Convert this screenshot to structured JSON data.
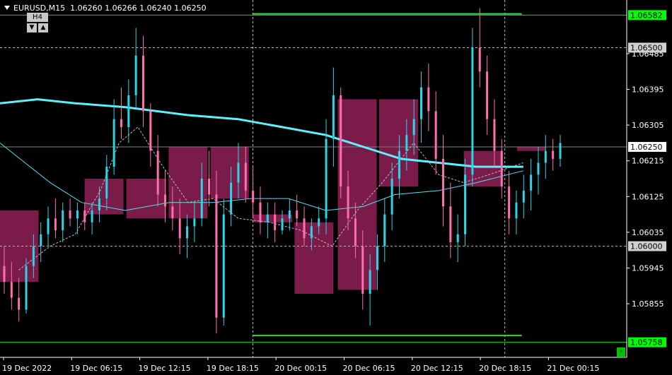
{
  "header": {
    "symbol": "EURUSD,M15",
    "ohlc": "1.06260 1.06266 1.06240 1.06250",
    "timeframe_badge": "H4",
    "btn_down": "▼",
    "btn_up": "▲",
    "corner_btn": "-"
  },
  "chart_data": {
    "type": "candlestick",
    "symbol": "EURUSD",
    "timeframe": "M15",
    "ylim": [
      1.0572,
      1.0662
    ],
    "y_ticks": [
      "1.06485",
      "1.06395",
      "1.06305",
      "1.06215",
      "1.06125",
      "1.06035",
      "1.05945",
      "1.05855"
    ],
    "x_ticks": [
      "19 Dec 2022",
      "19 Dec 06:15",
      "19 Dec 12:15",
      "19 Dec 18:15",
      "20 Dec 00:15",
      "20 Dec 06:15",
      "20 Dec 12:15",
      "20 Dec 18:15",
      "21 Dec 00:15"
    ],
    "price_tags": [
      {
        "value": "1.06582",
        "color": "#00ff00"
      },
      {
        "value": "1.06500",
        "color": "#d0d0d0"
      },
      {
        "value": "1.06250",
        "color": "#ffffff"
      },
      {
        "value": "1.06000",
        "color": "#d0d0d0"
      },
      {
        "value": "1.05758",
        "color": "#00ff00"
      }
    ],
    "horizontal_lines": [
      {
        "value": 1.06582,
        "style": "solid",
        "color": "#00e000"
      },
      {
        "value": 1.065,
        "style": "dotted",
        "color": "#bbbbbb"
      },
      {
        "value": 1.0625,
        "style": "solid-thin",
        "color": "#7f7f7f"
      },
      {
        "value": 1.06,
        "style": "dotted",
        "color": "#bbbbbb"
      },
      {
        "value": 1.05758,
        "style": "solid",
        "color": "#00e000"
      }
    ],
    "segments": [
      {
        "x0": 0.4035,
        "x1": 0.8325,
        "value": 1.06585,
        "color": "#33dd33"
      },
      {
        "x0": 0.4035,
        "x1": 0.8325,
        "value": 1.05775,
        "color": "#33dd33"
      }
    ],
    "v_separators": [
      0.4035,
      0.8055
    ],
    "h4_boxes": [
      {
        "x0": 0.0,
        "x1": 0.0615,
        "o": 1.0609,
        "c": 1.0591
      },
      {
        "x0": 0.135,
        "x1": 0.197,
        "o": 1.0617,
        "c": 1.0608
      },
      {
        "x0": 0.2015,
        "x1": 0.265,
        "o": 1.0617,
        "c": 1.0607
      },
      {
        "x0": 0.269,
        "x1": 0.331,
        "o": 1.0625,
        "c": 1.0607
      },
      {
        "x0": 0.336,
        "x1": 0.397,
        "o": 1.0625,
        "c": 1.0612
      },
      {
        "x0": 0.4035,
        "x1": 0.466,
        "o": 1.0608,
        "c": 1.0606
      },
      {
        "x0": 0.47,
        "x1": 0.532,
        "o": 1.0606,
        "c": 1.0588
      },
      {
        "x0": 0.539,
        "x1": 0.601,
        "o": 1.0637,
        "c": 1.0589
      },
      {
        "x0": 0.605,
        "x1": 0.667,
        "o": 1.0637,
        "c": 1.0615
      },
      {
        "x0": 0.74,
        "x1": 0.802,
        "o": 1.0624,
        "c": 1.0615
      },
      {
        "x0": 0.825,
        "x1": 0.871,
        "o": 1.0625,
        "c": 1.0624
      }
    ],
    "candle_colors": {
      "up": "#2bd5e8",
      "down": "#ff6fb0",
      "box_up": "#1e7a78",
      "box_down": "#7a1b4a"
    },
    "series": [
      {
        "name": "",
        "kind": "ma-thick",
        "color": "#5ef0ff",
        "points": [
          [
            0.0,
            1.0636
          ],
          [
            0.06,
            1.0637
          ],
          [
            0.12,
            1.0636
          ],
          [
            0.2,
            1.0635
          ],
          [
            0.3,
            1.0633
          ],
          [
            0.38,
            1.0632
          ],
          [
            0.45,
            1.063
          ],
          [
            0.52,
            1.0628
          ],
          [
            0.58,
            1.0625
          ],
          [
            0.64,
            1.0622
          ],
          [
            0.7,
            1.0621
          ],
          [
            0.76,
            1.062
          ],
          [
            0.835,
            1.062
          ]
        ]
      },
      {
        "name": "",
        "kind": "ma-thin",
        "color": "#4fe0f0",
        "points": [
          [
            0.0,
            1.0626
          ],
          [
            0.04,
            1.0621
          ],
          [
            0.08,
            1.0616
          ],
          [
            0.13,
            1.0611
          ],
          [
            0.2,
            1.0609
          ],
          [
            0.27,
            1.0611
          ],
          [
            0.34,
            1.0611
          ],
          [
            0.4,
            1.0612
          ],
          [
            0.46,
            1.0612
          ],
          [
            0.52,
            1.0609
          ],
          [
            0.58,
            1.061
          ],
          [
            0.63,
            1.0613
          ],
          [
            0.7,
            1.0614
          ],
          [
            0.76,
            1.0616
          ],
          [
            0.835,
            1.0619
          ]
        ]
      },
      {
        "name": "",
        "kind": "ma-dash",
        "color": "#bbbbbb",
        "points": [
          [
            0.03,
            1.0594
          ],
          [
            0.08,
            1.06
          ],
          [
            0.12,
            1.0603
          ],
          [
            0.16,
            1.0614
          ],
          [
            0.19,
            1.0626
          ],
          [
            0.22,
            1.063
          ],
          [
            0.26,
            1.062
          ],
          [
            0.3,
            1.0611
          ],
          [
            0.34,
            1.0612
          ],
          [
            0.38,
            1.0607
          ],
          [
            0.43,
            1.0606
          ],
          [
            0.48,
            1.0604
          ],
          [
            0.53,
            1.06
          ],
          [
            0.57,
            1.0609
          ],
          [
            0.61,
            1.0616
          ],
          [
            0.66,
            1.0626
          ],
          [
            0.7,
            1.0618
          ],
          [
            0.74,
            1.0616
          ],
          [
            0.78,
            1.0618
          ],
          [
            0.835,
            1.0621
          ]
        ]
      }
    ],
    "candles": [
      [
        1.0595,
        1.06,
        1.0588,
        1.0591
      ],
      [
        1.0591,
        1.0596,
        1.0584,
        1.0587
      ],
      [
        1.0587,
        1.0592,
        1.0581,
        1.0584
      ],
      [
        1.0584,
        1.0597,
        1.0583,
        1.0595
      ],
      [
        1.0595,
        1.0603,
        1.0592,
        1.06
      ],
      [
        1.06,
        1.0606,
        1.0596,
        1.0603
      ],
      [
        1.0603,
        1.061,
        1.06,
        1.0607
      ],
      [
        1.0607,
        1.0612,
        1.0602,
        1.0604
      ],
      [
        1.0604,
        1.0611,
        1.0601,
        1.0609
      ],
      [
        1.0609,
        1.0612,
        1.0605,
        1.0607
      ],
      [
        1.0607,
        1.0611,
        1.0603,
        1.0609
      ],
      [
        1.0609,
        1.0611,
        1.0604,
        1.0606
      ],
      [
        1.0606,
        1.0611,
        1.0603,
        1.0609
      ],
      [
        1.0609,
        1.0615,
        1.0606,
        1.0612
      ],
      [
        1.0612,
        1.0623,
        1.0609,
        1.062
      ],
      [
        1.062,
        1.0637,
        1.0618,
        1.0632
      ],
      [
        1.0632,
        1.064,
        1.0627,
        1.063
      ],
      [
        1.063,
        1.0642,
        1.0626,
        1.0638
      ],
      [
        1.0638,
        1.0655,
        1.0635,
        1.0648
      ],
      [
        1.0648,
        1.0653,
        1.063,
        1.0634
      ],
      [
        1.0634,
        1.0636,
        1.062,
        1.0624
      ],
      [
        1.0624,
        1.0628,
        1.061,
        1.0613
      ],
      [
        1.0613,
        1.0619,
        1.0606,
        1.061
      ],
      [
        1.061,
        1.0615,
        1.0604,
        1.0607
      ],
      [
        1.0607,
        1.0612,
        1.0598,
        1.0602
      ],
      [
        1.0602,
        1.0608,
        1.0597,
        1.0605
      ],
      [
        1.0605,
        1.0611,
        1.0601,
        1.0607
      ],
      [
        1.0607,
        1.0621,
        1.0605,
        1.0617
      ],
      [
        1.0617,
        1.0624,
        1.061,
        1.0613
      ],
      [
        1.0613,
        1.0619,
        1.0578,
        1.0582
      ],
      [
        1.0582,
        1.0612,
        1.058,
        1.0608
      ],
      [
        1.0608,
        1.062,
        1.0605,
        1.0616
      ],
      [
        1.0616,
        1.0626,
        1.0612,
        1.0621
      ],
      [
        1.0621,
        1.0625,
        1.0611,
        1.0614
      ],
      [
        1.0614,
        1.062,
        1.0607,
        1.0611
      ],
      [
        1.0611,
        1.0615,
        1.0603,
        1.0606
      ],
      [
        1.0606,
        1.0611,
        1.0602,
        1.0608
      ],
      [
        1.0608,
        1.0611,
        1.0601,
        1.0604
      ],
      [
        1.0604,
        1.0609,
        1.0603,
        1.0607
      ],
      [
        1.0607,
        1.0612,
        1.0604,
        1.0609
      ],
      [
        1.0609,
        1.0613,
        1.0605,
        1.0607
      ],
      [
        1.0607,
        1.061,
        1.06,
        1.0602
      ],
      [
        1.0602,
        1.0607,
        1.0599,
        1.0605
      ],
      [
        1.0605,
        1.061,
        1.0603,
        1.0607
      ],
      [
        1.0607,
        1.0632,
        1.0603,
        1.0627
      ],
      [
        1.0627,
        1.0645,
        1.062,
        1.0638
      ],
      [
        1.0638,
        1.064,
        1.0612,
        1.0615
      ],
      [
        1.0615,
        1.0619,
        1.0604,
        1.0607
      ],
      [
        1.0607,
        1.0611,
        1.0597,
        1.06
      ],
      [
        1.06,
        1.0604,
        1.0584,
        1.0588
      ],
      [
        1.0588,
        1.0598,
        1.058,
        1.0594
      ],
      [
        1.0594,
        1.0603,
        1.0589,
        1.06
      ],
      [
        1.06,
        1.0612,
        1.0596,
        1.0608
      ],
      [
        1.0608,
        1.0621,
        1.0604,
        1.0617
      ],
      [
        1.0617,
        1.0628,
        1.0612,
        1.0624
      ],
      [
        1.0624,
        1.0632,
        1.0619,
        1.0628
      ],
      [
        1.0628,
        1.0637,
        1.0623,
        1.0632
      ],
      [
        1.0632,
        1.0644,
        1.0626,
        1.064
      ],
      [
        1.064,
        1.0646,
        1.0629,
        1.0634
      ],
      [
        1.0634,
        1.0639,
        1.0618,
        1.0622
      ],
      [
        1.0622,
        1.0628,
        1.0605,
        1.061
      ],
      [
        1.061,
        1.0616,
        1.0597,
        1.0601
      ],
      [
        1.0601,
        1.0608,
        1.0596,
        1.0603
      ],
      [
        1.0603,
        1.0622,
        1.06,
        1.0618
      ],
      [
        1.0618,
        1.0655,
        1.0615,
        1.065
      ],
      [
        1.065,
        1.066,
        1.064,
        1.0644
      ],
      [
        1.0644,
        1.0648,
        1.0628,
        1.0632
      ],
      [
        1.0632,
        1.0637,
        1.062,
        1.0624
      ],
      [
        1.0624,
        1.0627,
        1.0612,
        1.0615
      ],
      [
        1.0615,
        1.0619,
        1.0603,
        1.0607
      ],
      [
        1.0607,
        1.0614,
        1.0603,
        1.0611
      ],
      [
        1.0611,
        1.0618,
        1.0607,
        1.0614
      ],
      [
        1.0614,
        1.0622,
        1.0609,
        1.0618
      ],
      [
        1.0618,
        1.0625,
        1.0613,
        1.0621
      ],
      [
        1.0621,
        1.0628,
        1.0617,
        1.0624
      ],
      [
        1.0624,
        1.0627,
        1.0619,
        1.0622
      ],
      [
        1.0622,
        1.0628,
        1.062,
        1.0626
      ]
    ]
  }
}
